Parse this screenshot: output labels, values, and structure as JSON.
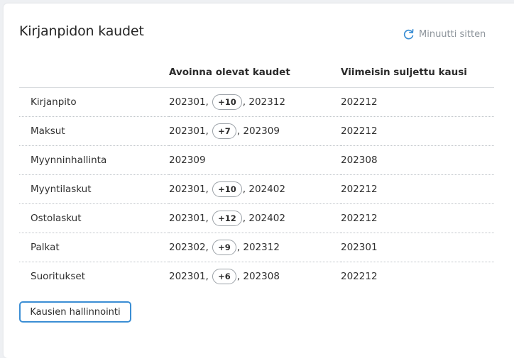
{
  "widget": {
    "title": "Kirjanpidon kaudet",
    "refresh_label": "Minuutti sitten",
    "refresh_icon": "refresh-icon",
    "accent_color": "#3b8ed4"
  },
  "table": {
    "headers": [
      "",
      "Avoinna olevat kaudet",
      "Viimeisin suljettu kausi"
    ],
    "rows": [
      {
        "name": "Kirjanpito",
        "open_first": "202301",
        "open_badge": "+10",
        "open_last": "202312",
        "last_closed": "202212"
      },
      {
        "name": "Maksut",
        "open_first": "202301",
        "open_badge": "+7",
        "open_last": "202309",
        "last_closed": "202212"
      },
      {
        "name": "Myynninhallinta",
        "open_first": "202309",
        "open_badge": "",
        "open_last": "",
        "last_closed": "202308"
      },
      {
        "name": "Myyntilaskut",
        "open_first": "202301",
        "open_badge": "+10",
        "open_last": "202402",
        "last_closed": "202212"
      },
      {
        "name": "Ostolaskut",
        "open_first": "202301",
        "open_badge": "+12",
        "open_last": "202402",
        "last_closed": "202212"
      },
      {
        "name": "Palkat",
        "open_first": "202302",
        "open_badge": "+9",
        "open_last": "202312",
        "last_closed": "202301"
      },
      {
        "name": "Suoritukset",
        "open_first": "202301",
        "open_badge": "+6",
        "open_last": "202308",
        "last_closed": "202212"
      }
    ]
  },
  "actions": {
    "manage_label": "Kausien hallinnointi"
  }
}
